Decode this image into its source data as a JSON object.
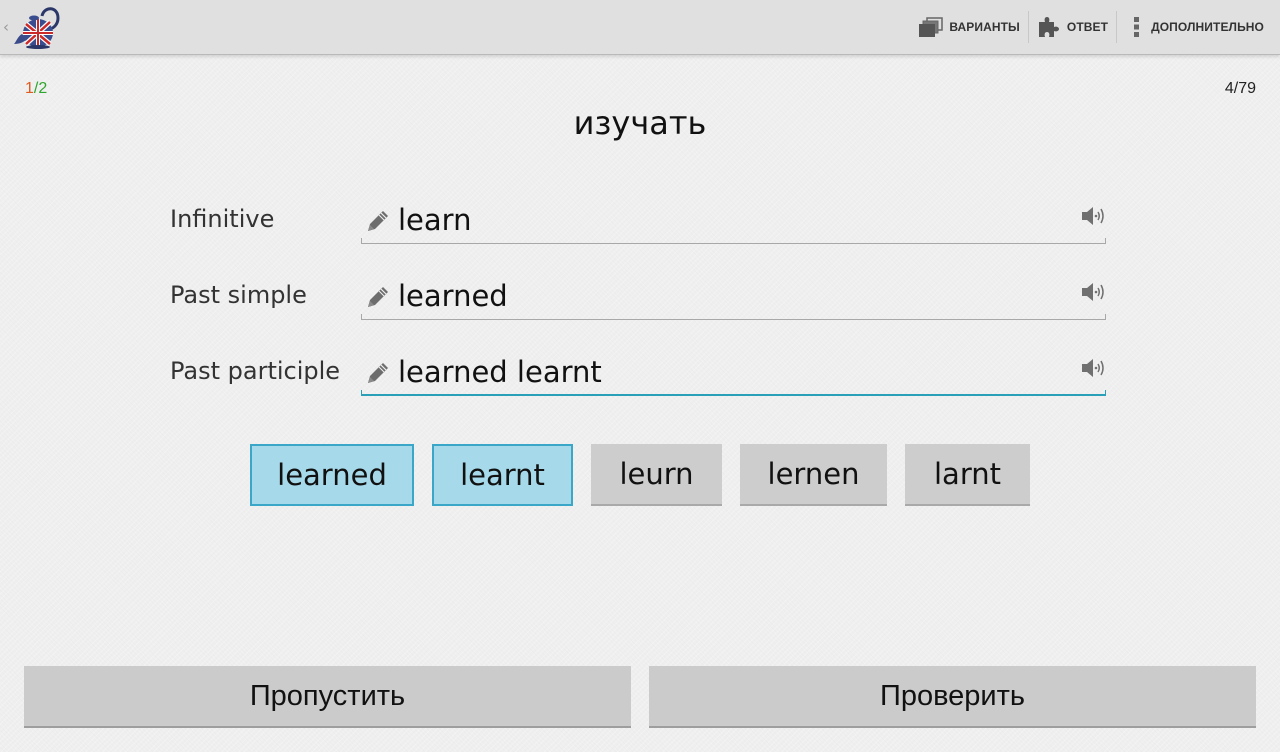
{
  "actionbar": {
    "actions": [
      {
        "label": "ВАРИАНТЫ",
        "icon": "cards-stack-icon"
      },
      {
        "label": "ОТВЕТ",
        "icon": "puzzle-piece-icon"
      },
      {
        "label": "ДОПОЛНИТЕЛЬНО",
        "icon": "overflow-menu-icon"
      }
    ],
    "up_glyph": "‹"
  },
  "progress": {
    "current": "1",
    "separator": "/",
    "total": "2",
    "current_color": "#e05a1e",
    "total_color": "#2ea52e",
    "card_counter": "4/79"
  },
  "word": "изучать",
  "forms": [
    {
      "label": "Infinitive",
      "value": "learn",
      "active": false
    },
    {
      "label": "Past simple",
      "value": "learned",
      "active": false
    },
    {
      "label": "Past participle",
      "value": "learned learnt",
      "active": true
    }
  ],
  "options": [
    {
      "label": "learned",
      "selected": true
    },
    {
      "label": "learnt",
      "selected": true
    },
    {
      "label": "leurn",
      "selected": false
    },
    {
      "label": "lernen",
      "selected": false
    },
    {
      "label": "larnt",
      "selected": false
    }
  ],
  "buttons": {
    "skip": "Пропустить",
    "check": "Проверить"
  },
  "colors": {
    "accent": "#2aa0b8",
    "selected_chip": "#a6d9ea"
  }
}
